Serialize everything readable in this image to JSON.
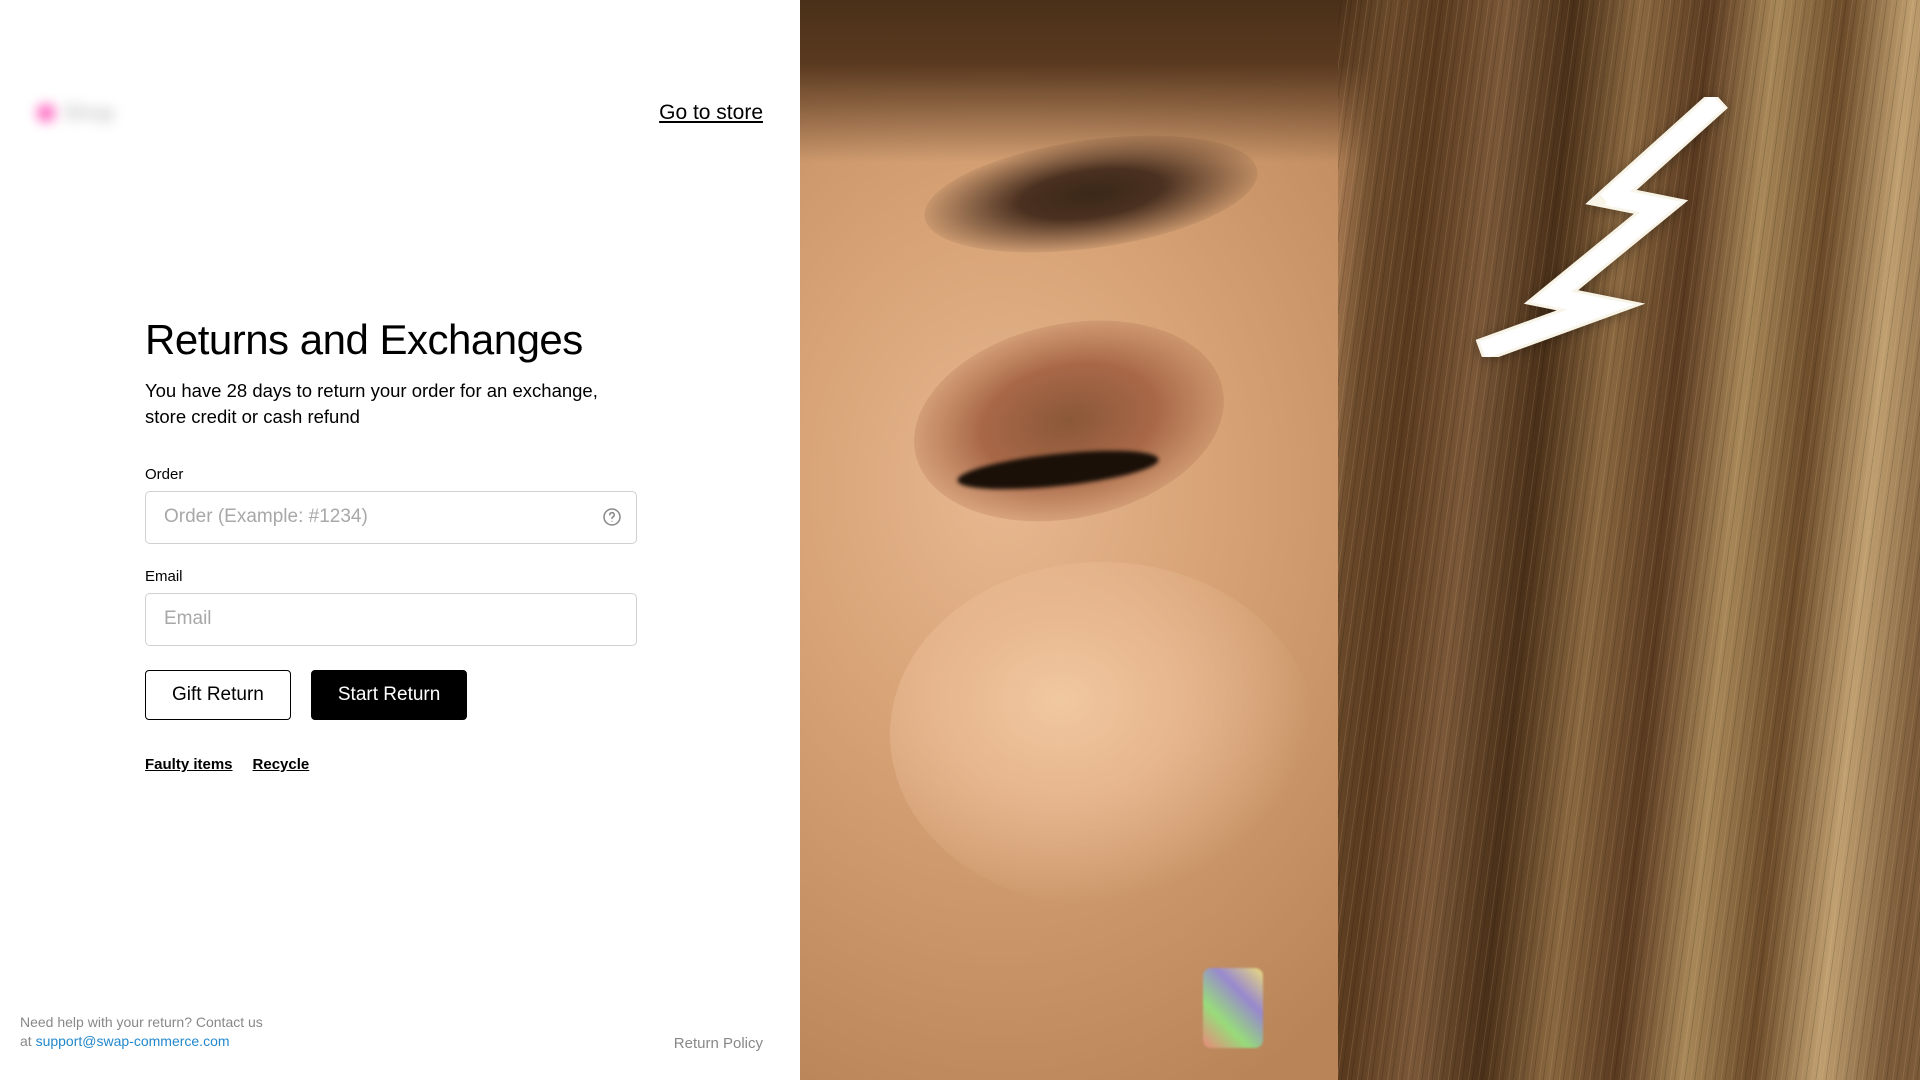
{
  "header": {
    "logo_text": "Shop",
    "go_to_store": "Go to store"
  },
  "main": {
    "title": "Returns and Exchanges",
    "subtitle": "You have 28 days to return your order for an exchange, store credit or cash refund",
    "order_label": "Order",
    "order_placeholder": "Order (Example: #1234)",
    "email_label": "Email",
    "email_placeholder": "Email",
    "gift_return_button": "Gift Return",
    "start_return_button": "Start Return",
    "faulty_items_link": "Faulty items",
    "recycle_link": "Recycle"
  },
  "footer": {
    "help_text_1": "Need help with your return? Contact us",
    "help_text_2": "at ",
    "support_email": "support@swap-commerce.com",
    "return_policy": "Return Policy"
  }
}
